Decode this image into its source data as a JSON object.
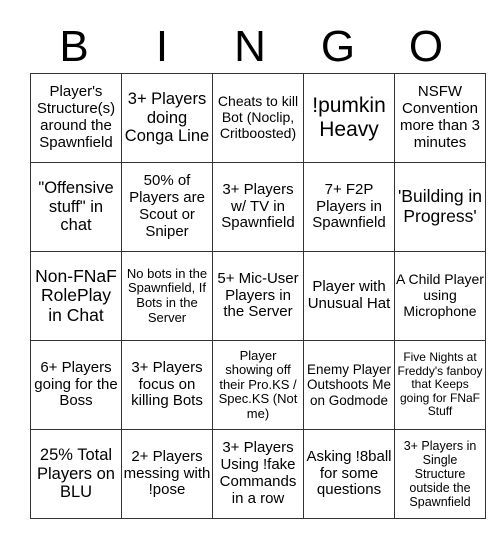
{
  "header": {
    "letters": [
      "B",
      "I",
      "N",
      "G",
      "O"
    ]
  },
  "board": {
    "rows": [
      [
        "Player's Structure(s) around the Spawnfield",
        "3+ Players doing Conga Line",
        "Cheats to kill Bot (Noclip, Critboosted)",
        "!pumkin Heavy",
        "NSFW Convention more than 3 minutes"
      ],
      [
        "\"Offensive stuff\" in chat",
        "50% of Players are Scout or Sniper",
        "3+ Players w/ TV in Spawnfield",
        "7+ F2P Players in Spawnfield",
        "'Building in Progress'"
      ],
      [
        "Non-FNaF RolePlay in Chat",
        "No bots in the Spawnfield, If Bots in the Server",
        "5+ Mic-User Players in the Server",
        "Player with Unusual Hat",
        "A Child Player using Microphone"
      ],
      [
        "6+ Players going for the Boss",
        "3+ Players focus on killing Bots",
        "Player showing off their Pro.KS / Spec.KS (Not me)",
        "Enemy Player Outshoots Me on Godmode",
        "Five Nights at Freddy's fanboy that Keeps going for FNaF Stuff"
      ],
      [
        "25% Total Players on BLU",
        "2+ Players messing with !pose",
        "3+ Players Using !fake Commands in a row",
        "Asking !8ball for some questions",
        "3+ Players in Single Structure outside the Spawnfield"
      ]
    ]
  }
}
